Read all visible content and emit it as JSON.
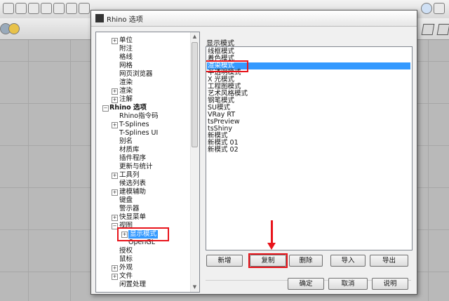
{
  "dialog": {
    "title": "Rhino 选项"
  },
  "tree": {
    "items": [
      {
        "label": "单位",
        "level": 2,
        "expander": "+"
      },
      {
        "label": "附注",
        "level": 2,
        "expander": ""
      },
      {
        "label": "格线",
        "level": 2,
        "expander": ""
      },
      {
        "label": "网格",
        "level": 2,
        "expander": ""
      },
      {
        "label": "网页浏览器",
        "level": 2,
        "expander": ""
      },
      {
        "label": "渲染",
        "level": 2,
        "expander": ""
      },
      {
        "label": "渲染",
        "level": 2,
        "expander": "+"
      },
      {
        "label": "注解",
        "level": 2,
        "expander": "+"
      },
      {
        "label": "Rhino 选项",
        "level": 1,
        "expander": "−",
        "bold": true
      },
      {
        "label": "Rhino指令码",
        "level": 2,
        "expander": ""
      },
      {
        "label": "T-Splines",
        "level": 2,
        "expander": "+"
      },
      {
        "label": "T-Splines UI",
        "level": 2,
        "expander": ""
      },
      {
        "label": "别名",
        "level": 2,
        "expander": ""
      },
      {
        "label": "材质库",
        "level": 2,
        "expander": ""
      },
      {
        "label": "插件程序",
        "level": 2,
        "expander": ""
      },
      {
        "label": "更新与统计",
        "level": 2,
        "expander": ""
      },
      {
        "label": "工具列",
        "level": 2,
        "expander": "+"
      },
      {
        "label": "候选列表",
        "level": 2,
        "expander": ""
      },
      {
        "label": "建模辅助",
        "level": 2,
        "expander": "+"
      },
      {
        "label": "键盘",
        "level": 2,
        "expander": ""
      },
      {
        "label": "警示器",
        "level": 2,
        "expander": ""
      },
      {
        "label": "快显菜单",
        "level": 2,
        "expander": "+"
      },
      {
        "label": "视图",
        "level": 2,
        "expander": "−"
      },
      {
        "label": "显示模式",
        "level": 3,
        "expander": "+",
        "selected": true
      },
      {
        "label": "OpenGL",
        "level": 3,
        "expander": ""
      },
      {
        "label": "授权",
        "level": 2,
        "expander": ""
      },
      {
        "label": "鼠标",
        "level": 2,
        "expander": ""
      },
      {
        "label": "外观",
        "level": 2,
        "expander": "+"
      },
      {
        "label": "文件",
        "level": 2,
        "expander": "+"
      },
      {
        "label": "闲置处理",
        "level": 2,
        "expander": ""
      }
    ]
  },
  "display_modes": {
    "group_label": "显示模式",
    "items": [
      "线框模式",
      "着色模式",
      "渲染模式",
      "半透明模式",
      "X 光模式",
      "工程图模式",
      "艺术风格模式",
      "钢笔模式",
      "SU模式",
      "VRay RT",
      "tsPreview",
      "tsShiny",
      "新模式",
      "新模式 01",
      "新模式 02"
    ],
    "selected_index": 2
  },
  "buttons": {
    "new": "新增",
    "copy": "复制",
    "delete": "删除",
    "import": "导入",
    "export": "导出",
    "ok": "确定",
    "cancel": "取消",
    "help": "说明"
  },
  "colors": {
    "selection": "#3399ff",
    "highlight_box": "#e8141b"
  }
}
